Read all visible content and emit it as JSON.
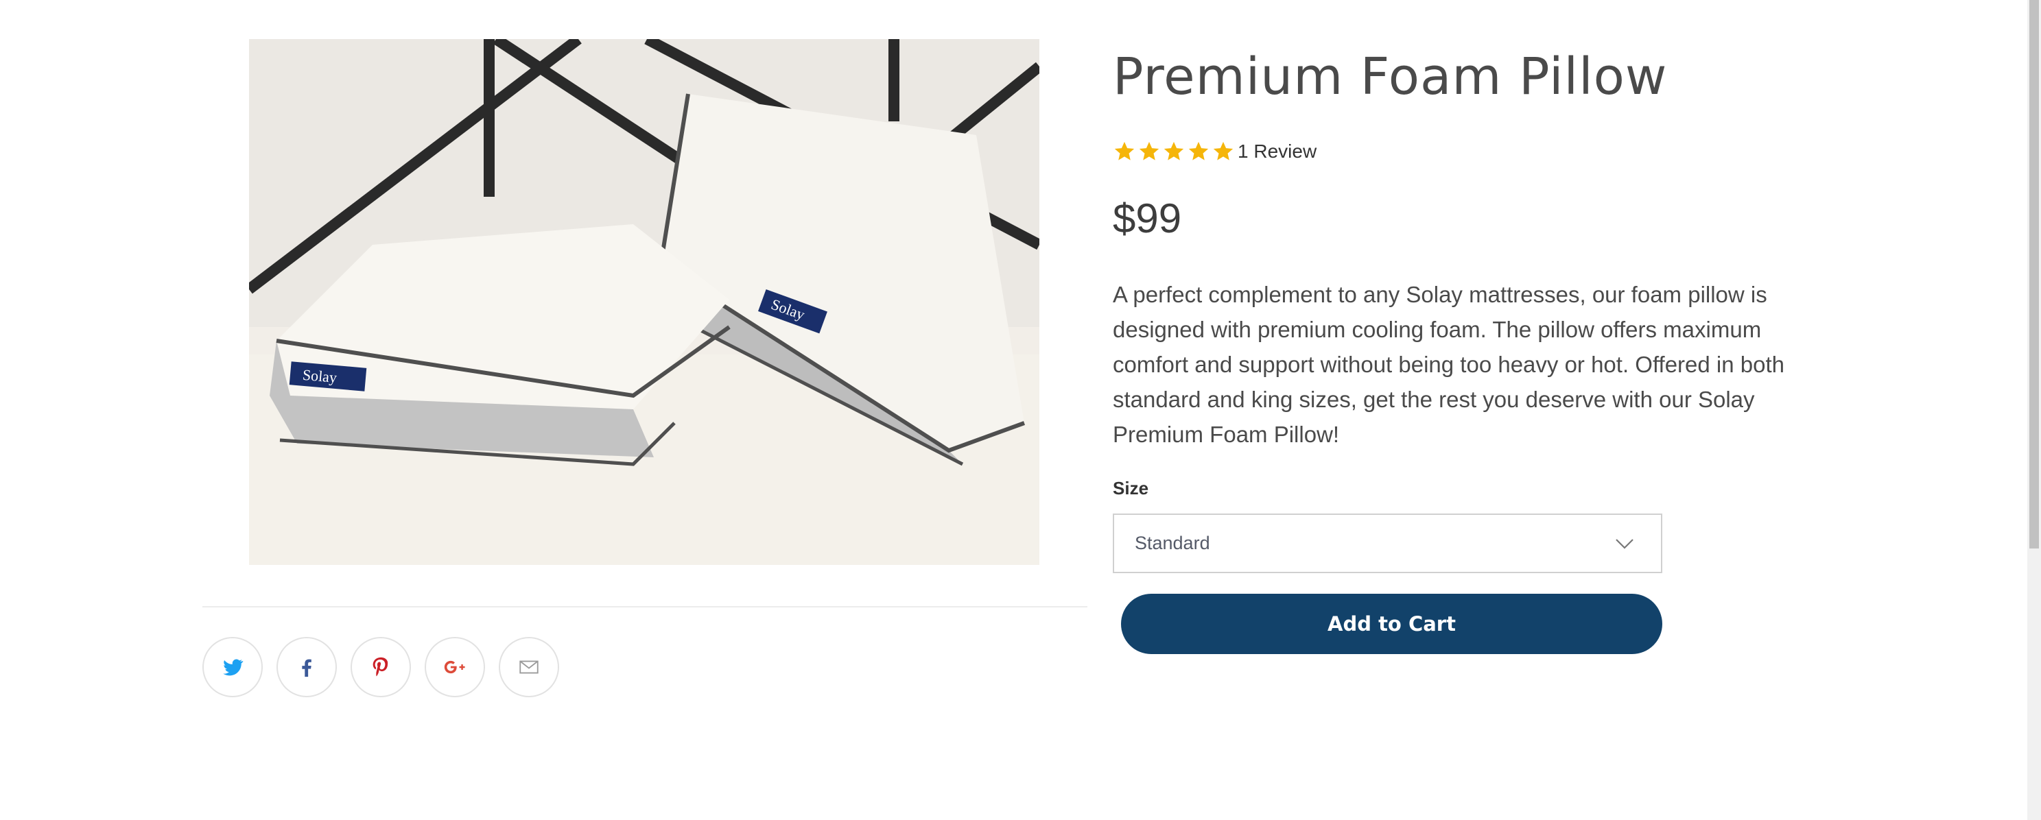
{
  "product": {
    "title": "Premium Foam Pillow",
    "rating": 5,
    "review_text": "1 Review",
    "price": "$99",
    "description": "A perfect complement to any Solay mattresses, our foam pillow is designed with premium cooling foam. The pillow offers maximum comfort and support without being too heavy or hot. Offered in both standard and king sizes, get the rest you deserve with our Solay Premium Foam Pillow!",
    "image_brand_label": "Solay"
  },
  "size": {
    "label": "Size",
    "selected": "Standard"
  },
  "cart": {
    "button_label": "Add to Cart"
  },
  "share": {
    "icons": [
      "twitter-icon",
      "facebook-icon",
      "pinterest-icon",
      "google-plus-icon",
      "email-icon"
    ]
  },
  "colors": {
    "accent": "#12426a",
    "star": "#f5b50a",
    "twitter": "#1da1f2",
    "facebook": "#3b5998",
    "pinterest": "#cb2027",
    "google_plus": "#dd4b39"
  }
}
